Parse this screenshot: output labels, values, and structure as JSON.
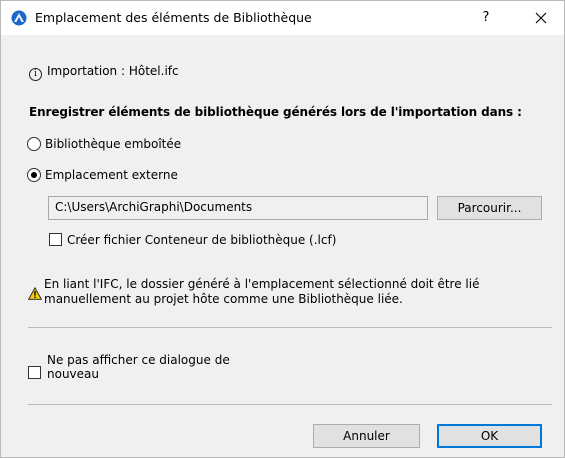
{
  "window": {
    "title": "Emplacement des éléments de Bibliothèque",
    "help_label": "?",
    "app_icon": "archicad-logo-icon",
    "close_icon": "close-icon"
  },
  "info": {
    "icon": "info-icon",
    "text": "Importation : Hôtel.ifc"
  },
  "heading": "Enregistrer éléments de bibliothèque générés lors de l'importation dans :",
  "options": {
    "embedded_label": "Bibliothèque emboîtée",
    "embedded_selected": false,
    "external_label": "Emplacement externe",
    "external_selected": true
  },
  "path": {
    "value": "C:\\Users\\ArchiGraphi\\Documents",
    "browse_label": "Parcourir..."
  },
  "container_checkbox": {
    "label": "Créer fichier Conteneur de bibliothèque (.lcf)",
    "checked": false
  },
  "warning": {
    "icon": "warning-icon",
    "text": "En liant l'IFC, le dossier généré à l'emplacement sélectionné doit être lié manuellement au projet hôte comme une Bibliothèque liée."
  },
  "dont_show": {
    "label": "Ne pas afficher ce dialogue de nouveau",
    "checked": false
  },
  "buttons": {
    "cancel_label": "Annuler",
    "ok_label": "OK"
  },
  "colors": {
    "accent": "#0078d7",
    "warning": "#f2c811",
    "dialog_bg": "#f0f0f0"
  }
}
